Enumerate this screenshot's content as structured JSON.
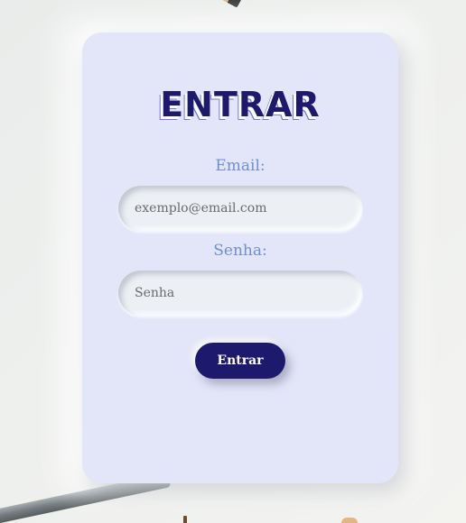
{
  "login": {
    "title": "ENTRAR",
    "email_label": "Email:",
    "email_placeholder": "exemplo@email.com",
    "email_value": "",
    "password_label": "Senha:",
    "password_placeholder": "Senha",
    "password_value": "",
    "submit_label": "Entrar"
  },
  "colors": {
    "card_background": "#e3e5f8",
    "title": "#1d1a6e",
    "label": "#6f8fd4",
    "button": "#1d1a6e",
    "button_text": "#ffffff",
    "input_background": "#eceff4"
  },
  "decor": {
    "top_item": "pencil-icon",
    "bottom_item": "pen-icon"
  }
}
